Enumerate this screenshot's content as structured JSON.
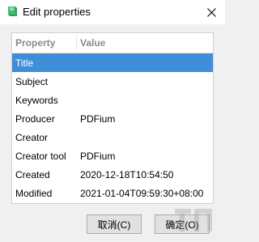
{
  "window": {
    "title": "Edit properties",
    "icon": "green-book-icon",
    "close": "close-icon"
  },
  "table": {
    "headers": {
      "property": "Property",
      "value": "Value"
    },
    "rows": [
      {
        "property": "Title",
        "value": "",
        "selected": true
      },
      {
        "property": "Subject",
        "value": ""
      },
      {
        "property": "Keywords",
        "value": ""
      },
      {
        "property": "Producer",
        "value": "PDFium"
      },
      {
        "property": "Creator",
        "value": ""
      },
      {
        "property": "Creator tool",
        "value": "PDFium"
      },
      {
        "property": "Created",
        "value": "2020-12-18T10:54:50"
      },
      {
        "property": "Modified",
        "value": "2021-01-04T09:59:30+08:00"
      }
    ]
  },
  "buttons": {
    "cancel": "取消(C)",
    "ok": "确定(O)"
  },
  "colors": {
    "selection": "#3f8fd8",
    "header_text": "#8a8a8a",
    "icon_green": "#2e9e5a"
  }
}
